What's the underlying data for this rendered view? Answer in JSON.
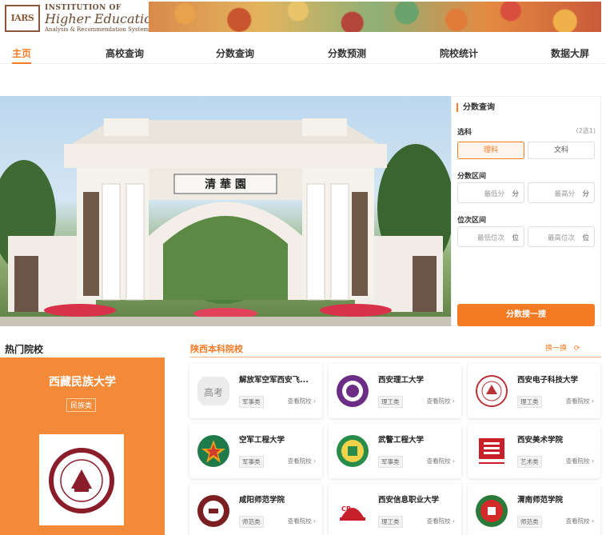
{
  "brand": {
    "logo_mark": "IARS",
    "line1": "INSTITUTION OF",
    "line2": "Higher Education",
    "line3": "Analysis & Recommendation System"
  },
  "nav": {
    "items": [
      {
        "label": "主页",
        "active": true
      },
      {
        "label": "高校查询"
      },
      {
        "label": "分数查询"
      },
      {
        "label": "分数预测"
      },
      {
        "label": "院校统计"
      },
      {
        "label": "数据大屏"
      }
    ]
  },
  "hero": {
    "plaque_text": "清 華 園"
  },
  "score_panel": {
    "title": "分数查询",
    "subject_label": "选科",
    "subject_hint": "(2选1)",
    "subjects": [
      "理科",
      "文科"
    ],
    "selected_subject": "理科",
    "score_range_label": "分数区间",
    "min_score_placeholder": "最低分",
    "max_score_placeholder": "最高分",
    "score_unit": "分",
    "rank_range_label": "位次区间",
    "min_rank_placeholder": "最低位次",
    "max_rank_placeholder": "最高位次",
    "rank_unit": "位",
    "search_button": "分数搜一搜"
  },
  "hot": {
    "title": "热门院校",
    "name": "西藏民族大学",
    "tag": "民族类"
  },
  "shaanxi": {
    "title": "陕西本科院校",
    "refresh": "换一换",
    "view_label": "查看院校",
    "universities": [
      {
        "name": "解放军空军西安飞...",
        "type": "军事类",
        "logo": "gaokao-icon"
      },
      {
        "name": "西安理工大学",
        "type": "理工类",
        "logo": "xaut-logo"
      },
      {
        "name": "西安电子科技大学",
        "type": "理工类",
        "logo": "xidian-logo"
      },
      {
        "name": "空军工程大学",
        "type": "军事类",
        "logo": "afeu-logo"
      },
      {
        "name": "武警工程大学",
        "type": "军事类",
        "logo": "wj-logo"
      },
      {
        "name": "西安美术学院",
        "type": "艺术类",
        "logo": "xafa-logo"
      },
      {
        "name": "咸阳师范学院",
        "type": "师范类",
        "logo": "xysf-logo"
      },
      {
        "name": "西安信息职业大学",
        "type": "理工类",
        "logo": "xaii-logo"
      },
      {
        "name": "渭南师范学院",
        "type": "师范类",
        "logo": "wnsf-logo"
      }
    ]
  },
  "colors": {
    "accent": "#f47a23",
    "hot_bg": "#f28a3a"
  }
}
